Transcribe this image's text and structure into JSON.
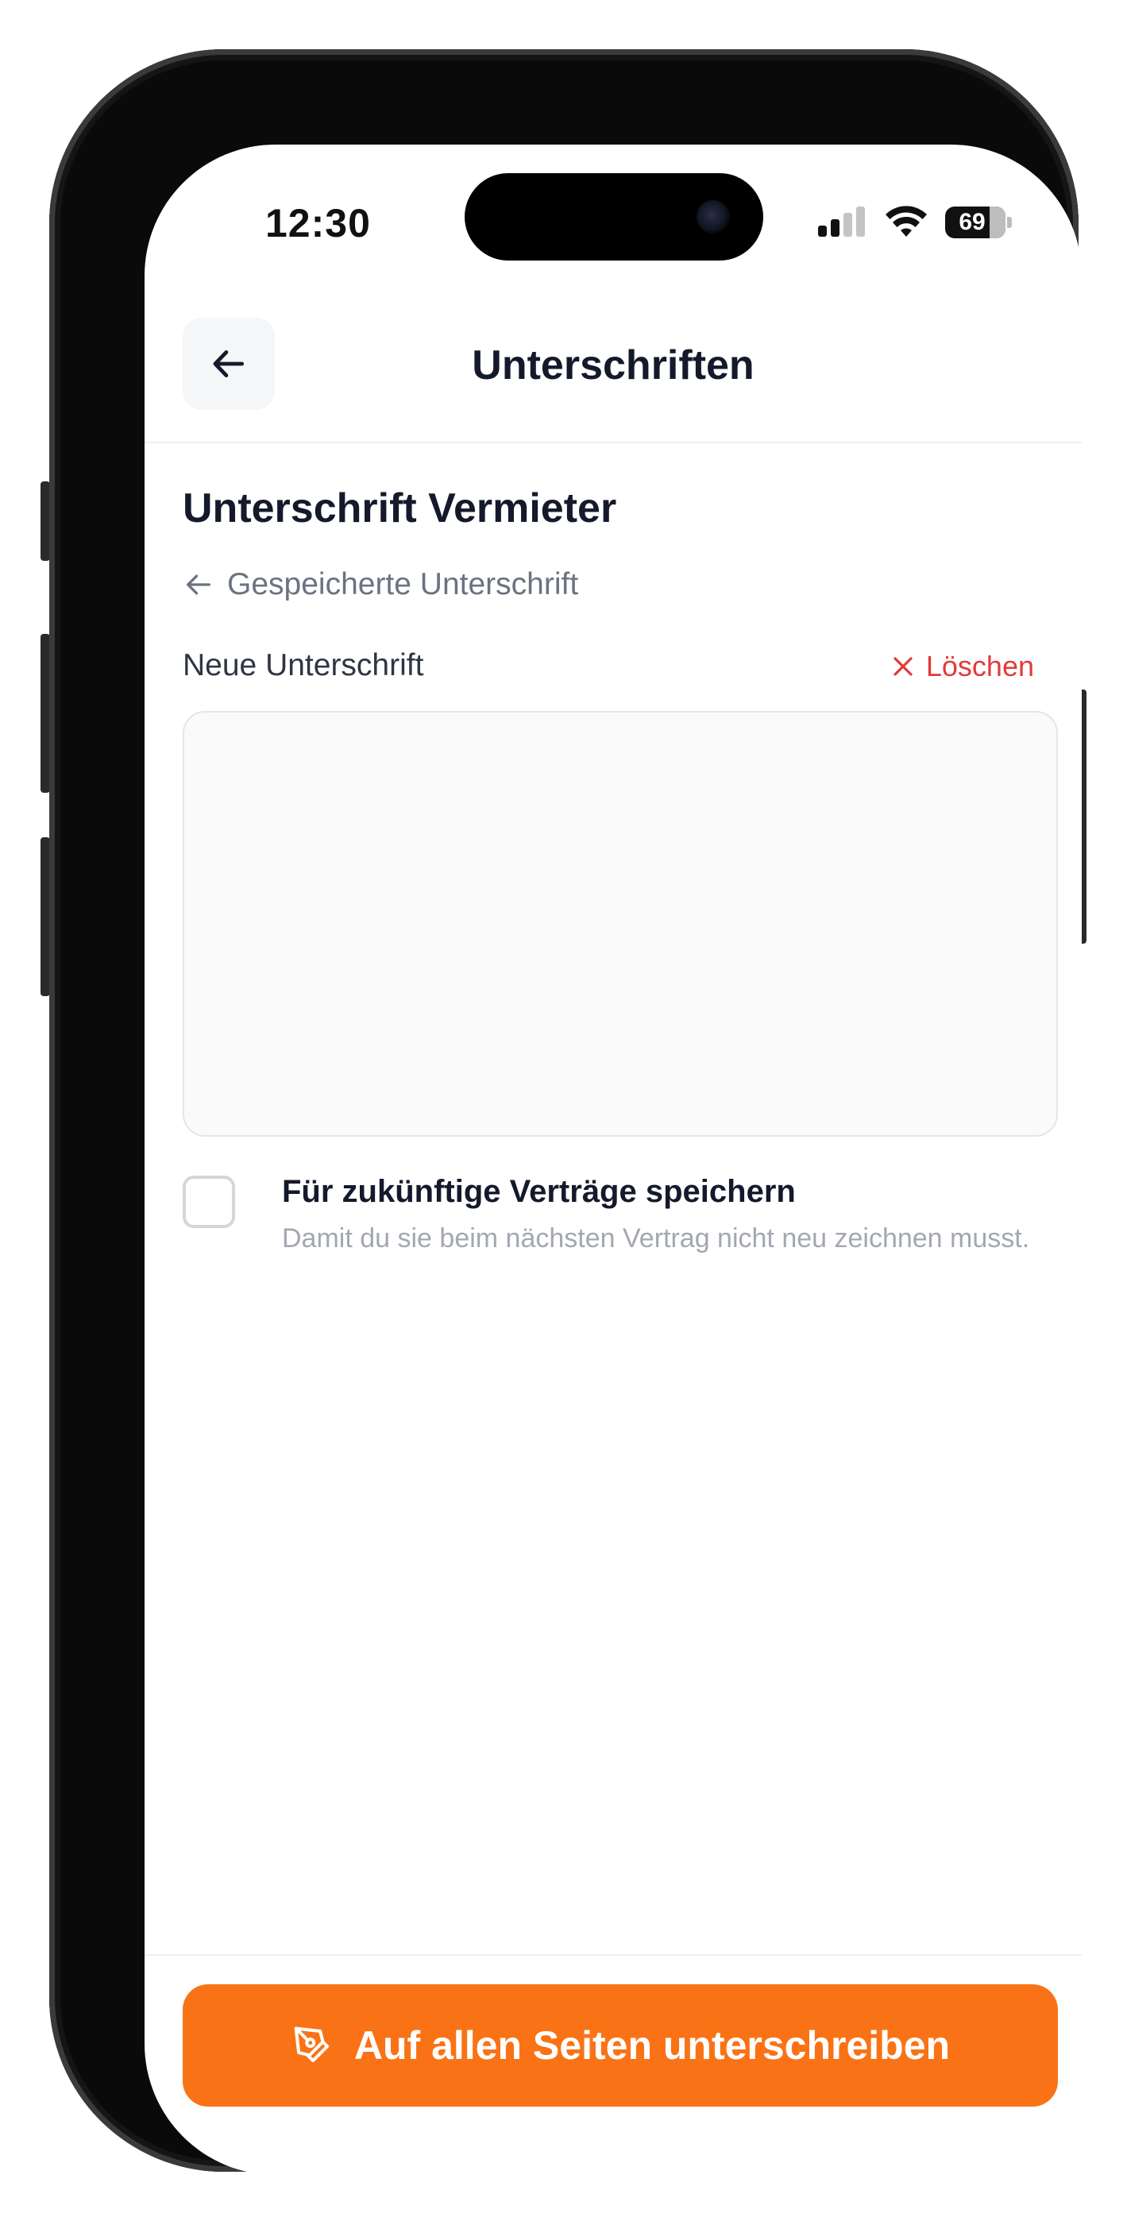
{
  "status_bar": {
    "time": "12:30",
    "battery_level": "69",
    "signal_bars_active": 2,
    "signal_bars_total": 4
  },
  "header": {
    "title": "Unterschriften",
    "back_icon": "arrow-left-icon"
  },
  "signature_section": {
    "title": "Unterschrift Vermieter",
    "saved_link_label": "Gespeicherte Unterschrift",
    "new_signature_label": "Neue Unterschrift",
    "clear_label": "Löschen",
    "clear_icon": "close-icon"
  },
  "save_option": {
    "label": "Für zukünftige Verträge speichern",
    "description": "Damit du sie beim nächsten Vertrag nicht neu zeichnen musst.",
    "checked": false
  },
  "footer": {
    "primary_button_label": "Auf allen Seiten unterschreiben",
    "primary_button_icon": "pen-tool-icon"
  },
  "colors": {
    "accent": "#f97316",
    "danger": "#e23a3a",
    "text_primary": "#141a2b",
    "text_secondary": "#6b7280"
  }
}
